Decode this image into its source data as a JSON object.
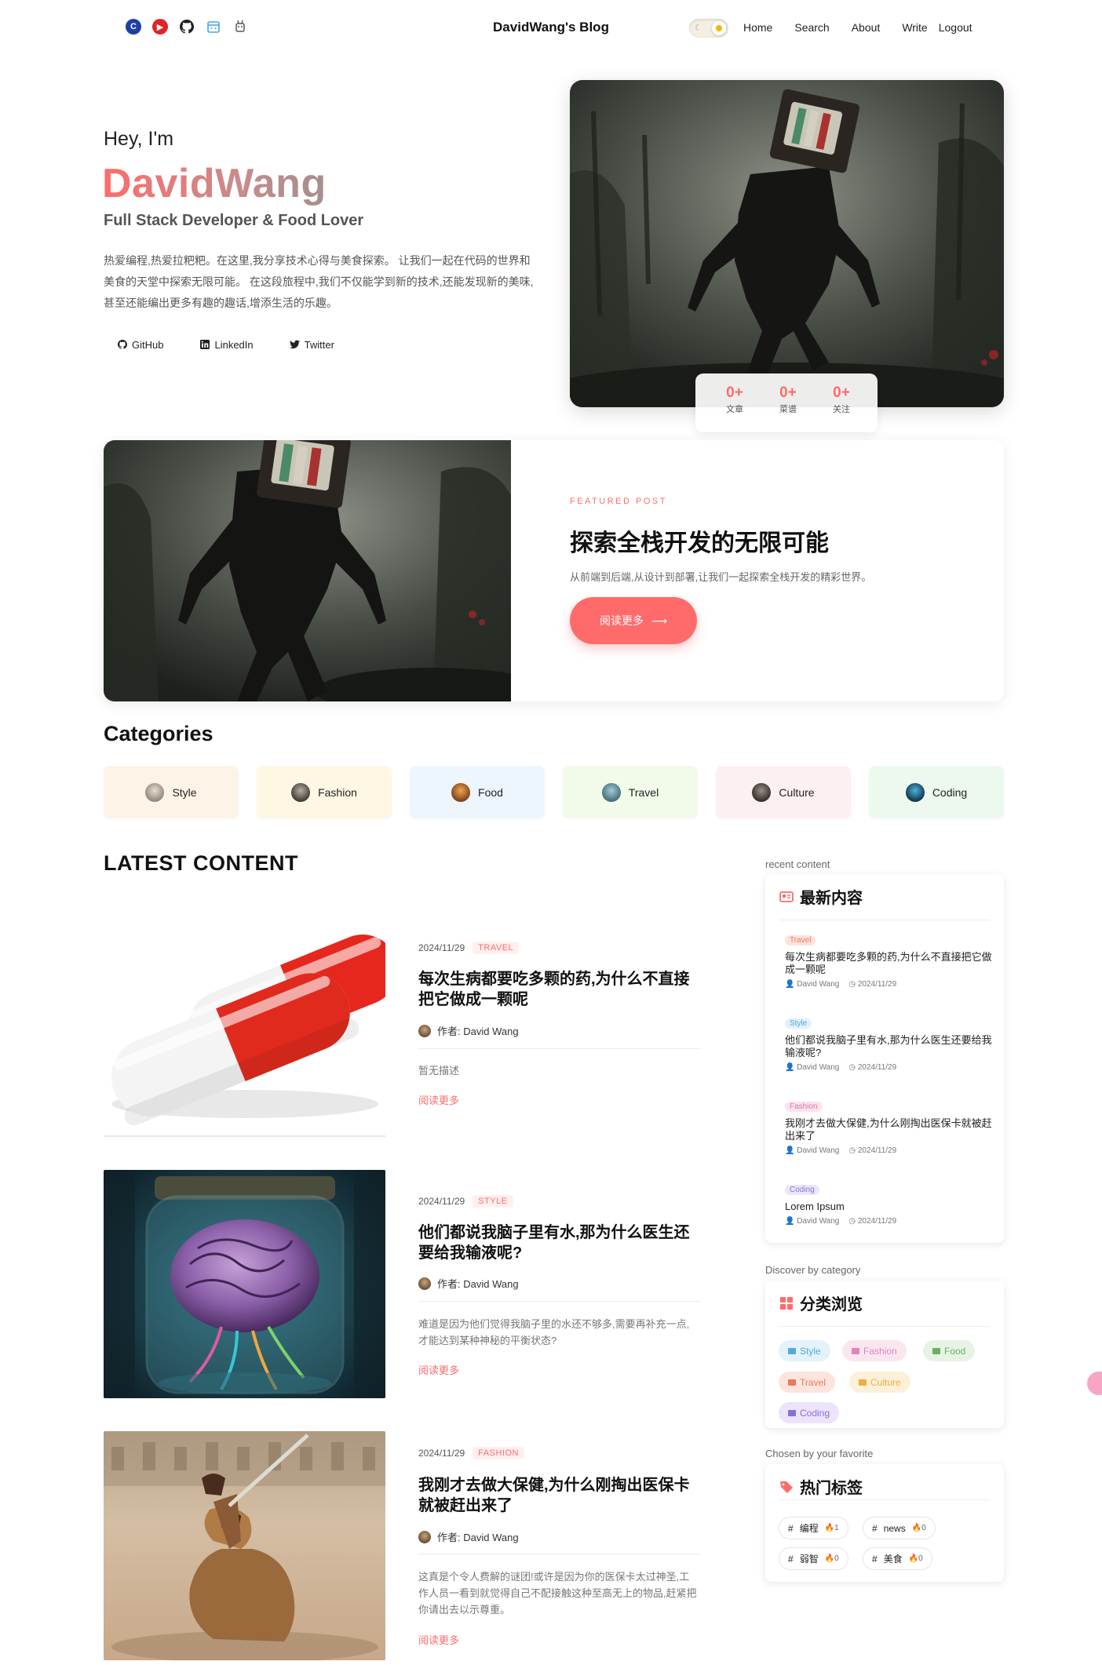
{
  "header": {
    "site_title": "DavidWang's Blog",
    "social_icons": [
      "csdn-icon",
      "youtube-icon",
      "github-icon",
      "calendar-icon",
      "robot-icon"
    ],
    "theme_toggle": "light",
    "nav": [
      {
        "label": "Home"
      },
      {
        "label": "Search"
      },
      {
        "label": "About"
      },
      {
        "label": "Write"
      },
      {
        "label": "Logout"
      }
    ]
  },
  "hero": {
    "greeting": "Hey, I'm",
    "name": "DavidWang",
    "role": "Full Stack Developer & Food Lover",
    "description": "热爱编程,热爱拉粑粑。在这里,我分享技术心得与美食探索。 让我们一起在代码的世界和美食的天堂中探索无限可能。 在这段旅程中,我们不仅能学到新的技术,还能发现新的美味,甚至还能编出更多有趣的趣话,增添生活的乐趣。",
    "links": [
      {
        "label": "GitHub",
        "icon": "github-icon"
      },
      {
        "label": "LinkedIn",
        "icon": "linkedin-icon"
      },
      {
        "label": "Twitter",
        "icon": "twitter-icon"
      }
    ],
    "stats": [
      {
        "value": "0+",
        "label": "文章"
      },
      {
        "value": "0+",
        "label": "菜谱"
      },
      {
        "value": "0+",
        "label": "关注"
      }
    ]
  },
  "featured": {
    "label": "FEATURED POST",
    "title": "探索全栈开发的无限可能",
    "description": "从前端到后端,从设计到部署,让我们一起探索全栈开发的精彩世界。",
    "button": "阅读更多",
    "button_icon": "arrow-right-icon"
  },
  "categories": {
    "title": "Categories",
    "items": [
      {
        "label": "Style",
        "bg": "#fdf3e7"
      },
      {
        "label": "Fashion",
        "bg": "#fdf7e4"
      },
      {
        "label": "Food",
        "bg": "#eef6fd"
      },
      {
        "label": "Travel",
        "bg": "#f2fae9"
      },
      {
        "label": "Culture",
        "bg": "#fdf0f0"
      },
      {
        "label": "Coding",
        "bg": "#edf9ef"
      }
    ]
  },
  "latest": {
    "title": "LATEST CONTENT",
    "posts": [
      {
        "date": "2024/11/29",
        "tag": "TRAVEL",
        "title": "每次生病都要吃多颗的药,为什么不直接把它做成一颗呢",
        "author": "作者: David Wang",
        "description": "暂无描述",
        "read_more": "阅读更多"
      },
      {
        "date": "2024/11/29",
        "tag": "STYLE",
        "title": "他们都说我脑子里有水,那为什么医生还要给我输液呢?",
        "author": "作者: David Wang",
        "description": "难道是因为他们觉得我脑子里的水还不够多,需要再补充一点,才能达到某种神秘的平衡状态?",
        "read_more": "阅读更多"
      },
      {
        "date": "2024/11/29",
        "tag": "FASHION",
        "title": "我刚才去做大保健,为什么刚掏出医保卡就被赶出来了",
        "author": "作者: David Wang",
        "description": "这真是个令人费解的谜团!或许是因为你的医保卡太过神圣,工作人员一看到就觉得自己不配接触这种至高无上的物品,赶紧把你请出去以示尊重。",
        "read_more": "阅读更多"
      }
    ]
  },
  "sidebar": {
    "recent": {
      "label": "recent content",
      "title": "最新内容",
      "items": [
        {
          "tag": "Travel",
          "title": "每次生病都要吃多颗的药,为什么不直接把它做成一颗呢",
          "author": "David Wang",
          "date": "2024/11/29"
        },
        {
          "tag": "Style",
          "title": "他们都说我脑子里有水,那为什么医生还要给我输液呢?",
          "author": "David Wang",
          "date": "2024/11/29"
        },
        {
          "tag": "Fashion",
          "title": "我刚才去做大保健,为什么刚掏出医保卡就被赶出来了",
          "author": "David Wang",
          "date": "2024/11/29"
        },
        {
          "tag": "Coding",
          "title": "Lorem Ipsum",
          "author": "David Wang",
          "date": "2024/11/29"
        }
      ]
    },
    "browse": {
      "label": "Discover by category",
      "title": "分类浏览",
      "chips": [
        "Style",
        "Fashion",
        "Food",
        "Travel",
        "Culture",
        "Coding"
      ]
    },
    "tags": {
      "label": "Chosen by your favorite",
      "title": "热门标签",
      "items": [
        {
          "name": "编程",
          "count": "1"
        },
        {
          "name": "news",
          "count": "0"
        },
        {
          "name": "弱智",
          "count": "0"
        },
        {
          "name": "美食",
          "count": "0"
        }
      ]
    }
  }
}
